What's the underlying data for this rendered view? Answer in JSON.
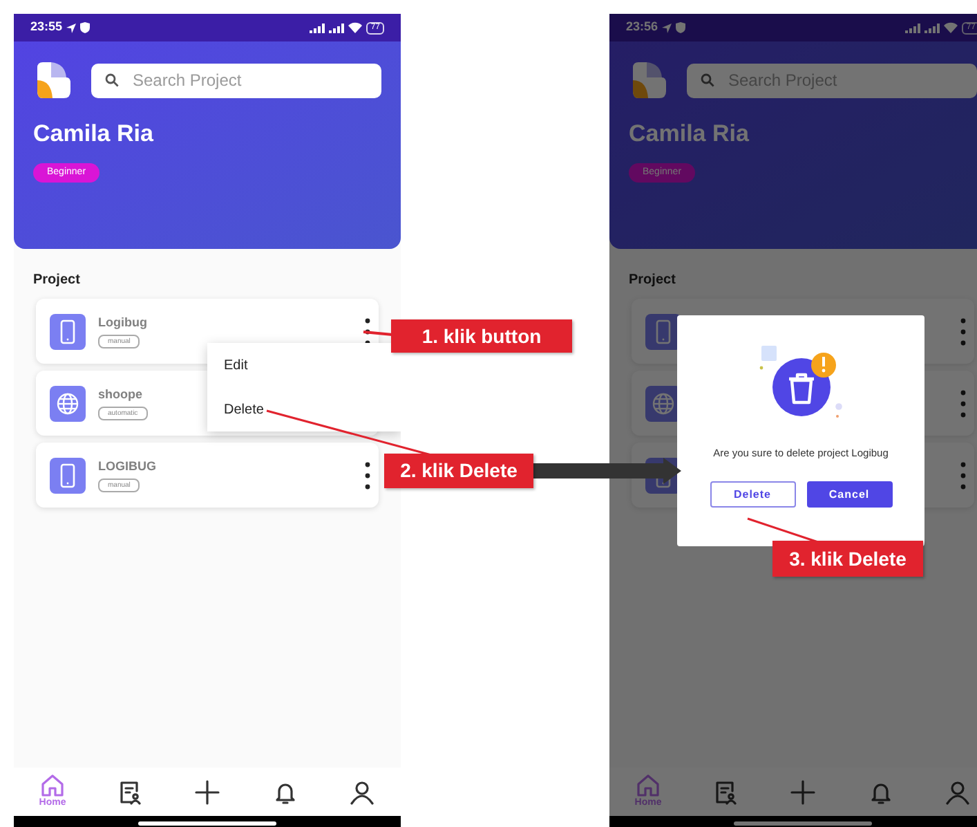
{
  "screens": [
    {
      "status_bar": {
        "time": "23:55",
        "battery": "77"
      },
      "dimmed": false,
      "search": {
        "placeholder": "Search Project"
      },
      "user": {
        "name": "Camila Ria",
        "level": "Beginner"
      },
      "section_title": "Project",
      "projects": [
        {
          "kind": "phone",
          "name": "Logibug",
          "type": "manual"
        },
        {
          "kind": "globe",
          "name": "shoope",
          "type": "automatic"
        },
        {
          "kind": "phone",
          "name": "LOGIBUG",
          "type": "manual"
        }
      ],
      "menu": {
        "items": [
          "Edit",
          "Delete"
        ]
      },
      "nav": [
        {
          "kind": "home",
          "label": "Home",
          "selected": true
        },
        {
          "kind": "document",
          "selected": false
        },
        {
          "kind": "plus",
          "selected": false
        },
        {
          "kind": "bell",
          "selected": false
        },
        {
          "kind": "person",
          "selected": false
        }
      ]
    },
    {
      "status_bar": {
        "time": "23:56",
        "battery": "77"
      },
      "dimmed": true,
      "search": {
        "placeholder": "Search Project"
      },
      "user": {
        "name": "Camila Ria",
        "level": "Beginner"
      },
      "section_title": "Project",
      "projects": [
        {
          "kind": "phone"
        },
        {
          "kind": "globe"
        },
        {
          "kind": "phone"
        }
      ],
      "dialog": {
        "message": "Are you sure to delete project Logibug",
        "buttons": [
          {
            "label": "Delete",
            "kind": "outline"
          },
          {
            "label": "Cancel",
            "kind": "primary"
          }
        ]
      },
      "nav": [
        {
          "kind": "home",
          "label": "Home",
          "selected": true
        },
        {
          "kind": "document",
          "selected": false
        },
        {
          "kind": "plus",
          "selected": false
        },
        {
          "kind": "bell",
          "selected": false
        },
        {
          "kind": "person",
          "selected": false
        }
      ]
    }
  ],
  "annotations": [
    {
      "label": "1. klik button"
    },
    {
      "label": "2. klik Delete"
    },
    {
      "label": "3. klik Delete"
    }
  ]
}
